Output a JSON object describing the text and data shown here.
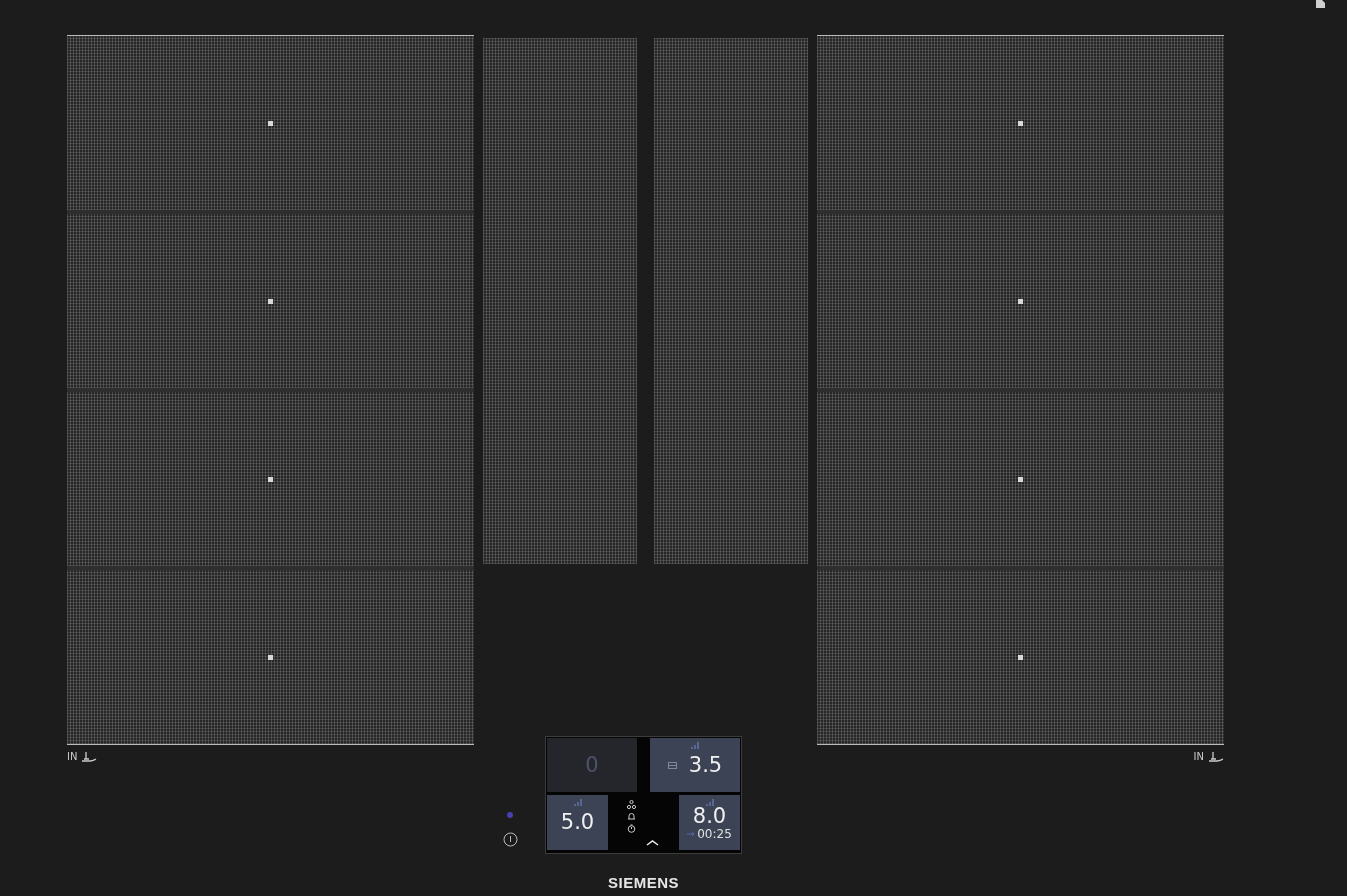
{
  "hob": {
    "left_label": "IN",
    "right_label": "IN"
  },
  "control_panel": {
    "top_tiles": [
      {
        "kind": "plain",
        "value": "0",
        "active": false
      },
      {
        "kind": "pan",
        "value": "3.5",
        "active": true
      }
    ],
    "bottom_tiles": [
      {
        "kind": "plain",
        "value": "5.0",
        "active": true
      },
      {
        "kind": "timer",
        "value": "8.0",
        "active": true,
        "timer": "00:25"
      }
    ]
  },
  "status_dot": {
    "on": true
  },
  "brand": "SIEMENS"
}
